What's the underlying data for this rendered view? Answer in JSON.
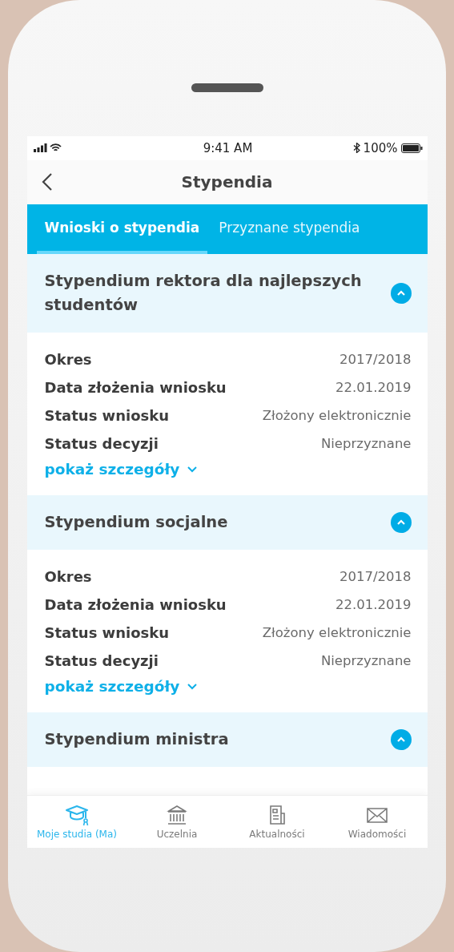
{
  "status_bar": {
    "time": "9:41 AM",
    "battery": "100%"
  },
  "title": "Stypendia",
  "tabs": [
    {
      "label": "Wnioski o stypendia",
      "selected": true
    },
    {
      "label": "Przyznane stypendia",
      "selected": false
    }
  ],
  "scholarships": [
    {
      "title": "Stypendium rektora dla najlepszych studentów",
      "expanded": true,
      "rows": [
        {
          "label": "Okres",
          "value": "2017/2018"
        },
        {
          "label": "Data złożenia wniosku",
          "value": "22.01.2019"
        },
        {
          "label": "Status wniosku",
          "value": "Złożony elektronicznie"
        },
        {
          "label": "Status decyzji",
          "value": "Nieprzyznane"
        }
      ],
      "details_link": "pokaż szczegóły"
    },
    {
      "title": "Stypendium socjalne",
      "expanded": true,
      "rows": [
        {
          "label": "Okres",
          "value": "2017/2018"
        },
        {
          "label": "Data złożenia wniosku",
          "value": "22.01.2019"
        },
        {
          "label": "Status wniosku",
          "value": "Złożony elektronicznie"
        },
        {
          "label": "Status decyzji",
          "value": "Nieprzyznane"
        }
      ],
      "details_link": "pokaż szczegóły"
    },
    {
      "title": "Stypendium ministra",
      "expanded": true
    }
  ],
  "bottom_nav": [
    {
      "kind": "studies",
      "label": "Moje studia (Ma)",
      "selected": true
    },
    {
      "kind": "university",
      "label": "Uczelnia",
      "selected": false
    },
    {
      "kind": "news",
      "label": "Aktualności",
      "selected": false
    },
    {
      "kind": "messages",
      "label": "Wiadomości",
      "selected": false
    }
  ]
}
